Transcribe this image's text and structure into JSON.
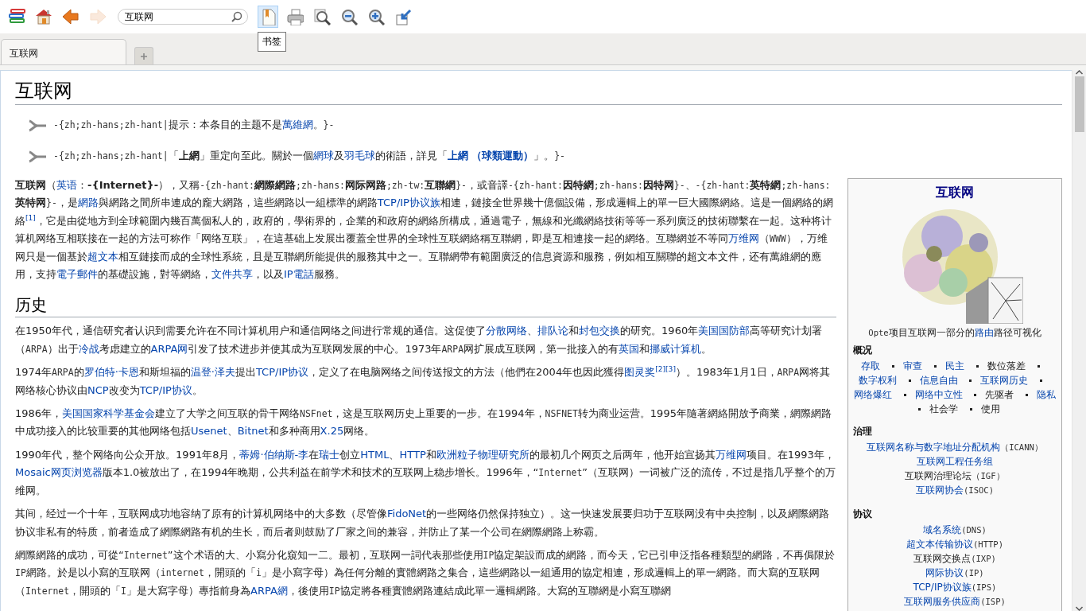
{
  "toolbar": {
    "nav_buttons": [
      {
        "kind": "library",
        "disabled": false
      },
      {
        "kind": "home",
        "disabled": false
      },
      {
        "kind": "back",
        "disabled": false
      },
      {
        "kind": "forward",
        "disabled": true
      }
    ],
    "search": {
      "value": "互联网"
    },
    "tool_buttons": [
      {
        "kind": "bookmark",
        "highlighted": true
      },
      {
        "kind": "print",
        "highlighted": false
      },
      {
        "kind": "zoom-reset",
        "highlighted": false
      },
      {
        "kind": "zoom-out",
        "highlighted": false
      },
      {
        "kind": "zoom-in",
        "highlighted": false
      },
      {
        "kind": "export",
        "highlighted": false
      }
    ],
    "tooltip": "书签"
  },
  "tabs": [
    {
      "label": "互联网",
      "selected": true
    }
  ],
  "article": {
    "title": "互联网",
    "hatnotes": [
      [
        {
          "mono": "-{zh;zh-hans;zh-hant|"
        },
        "提示：本条目的主题不是",
        {
          "link": "萬維網"
        },
        "。",
        {
          "mono": "}-"
        }
      ],
      [
        {
          "mono": "-{zh;zh-hans;zh-hant|"
        },
        "「",
        {
          "bold": "上網"
        },
        "」重定向至此。關於一個",
        {
          "link": "網球"
        },
        "及",
        {
          "link": "羽毛球"
        },
        "的術語，詳見「",
        {
          "boldlink": "上網 （球類運動）"
        },
        "」。",
        {
          "mono": "}-"
        }
      ]
    ],
    "intro": [
      {
        "bold": "互联网"
      },
      "（",
      {
        "link": "英语"
      },
      "：",
      {
        "bold": "-{Internet}-"
      },
      "），又稱",
      {
        "mono": "-{zh-hant:"
      },
      {
        "bold": "網際網路"
      },
      {
        "mono": ";zh-hans:"
      },
      {
        "bold": "网际网路"
      },
      {
        "mono": ";zh-tw:"
      },
      {
        "bold": "互聯網"
      },
      {
        "mono": "}-"
      },
      "，或音譯",
      {
        "mono": "-{zh-hant:"
      },
      {
        "bold": "因特網"
      },
      {
        "mono": ";zh-hans:"
      },
      {
        "bold": "因特网"
      },
      {
        "mono": "}-"
      },
      "、",
      {
        "mono": "-{zh-hant:"
      },
      {
        "bold": "英特網"
      },
      {
        "mono": ";zh-hans:"
      },
      {
        "bold": "英特网"
      },
      {
        "mono": "}-"
      },
      "，是",
      {
        "link": "網路"
      },
      "與網路之間所串連成的龐大網路，這些網路以一組標準的網路",
      {
        "link": "TCP/IP协议族"
      },
      "相連，鏈接全世界幾十億個設備，形成邏輯上的單一巨大國際網絡。這是一個網絡的網絡",
      {
        "ref": "[1]"
      },
      "，它是由從地方到全球範圍內幾百萬個私人的，政府的，學術界的，企業的和政府的網絡所構成，通過電子，無線和光纖網絡技術等等一系列廣泛的技術聯繫在一起。这种将计算机网络互相联接在一起的方法可称作「网络互联」，在這基础上发展出覆蓋全世界的全球性互联網絡稱互聯網，即是互相連接一起的網络。互聯網並不等同",
      {
        "link": "万维网"
      },
      "（",
      {
        "mono": "WWW"
      },
      "），万维网只是一個基於",
      {
        "link": "超文本"
      },
      "相互鏈接而成的全球性系統，且是互聯網所能提供的服務其中之一。互聯網帶有範圍廣泛的信息資源和服務，例如相互關聯的超文本文件，还有萬維網的應用，支持",
      {
        "link": "電子郵件"
      },
      "的基礎設施，對等網絡，",
      {
        "link": "文件共享"
      },
      "，以及",
      {
        "link": "IP電話"
      },
      "服務。"
    ],
    "sections": [
      {
        "heading": "历史",
        "paragraphs": [
          [
            "在1950年代，通信研究者认识到需要允许在不同计算机用户和通信网络之间进行常规的通信。这促使了",
            {
              "link": "分散网络"
            },
            "、",
            {
              "link": "排队论"
            },
            "和",
            {
              "link": "封包交换"
            },
            "的研究。1960年",
            {
              "link": "美国国防部"
            },
            "高等研究计划署（",
            {
              "mono": "ARPA"
            },
            "）出于",
            {
              "link": "冷战"
            },
            "考虑建立的",
            {
              "link": "ARPA网"
            },
            "引发了技术进步并使其成为互联网发展的中心。1973年",
            {
              "mono": "ARPA"
            },
            "网扩展成互联网，第一批接入的有",
            {
              "link": "英国"
            },
            "和",
            {
              "link": "挪威计算机"
            },
            "。"
          ],
          [
            "1974年",
            {
              "mono": "ARPA"
            },
            "的",
            {
              "link": "罗伯特·卡恩"
            },
            "和斯坦福的",
            {
              "link": "温登·泽夫"
            },
            "提出",
            {
              "link": "TCP/IP协议"
            },
            "，定义了在电脑网络之间传送报文的方法（他們在2004年也因此獲得",
            {
              "link": "图灵奖"
            },
            {
              "ref": "[2]"
            },
            {
              "ref": "[3]"
            },
            "）。1983年1月1日，",
            {
              "mono": "ARPA"
            },
            "网将其网络核心协议由",
            {
              "link": "NCP"
            },
            "改变为",
            {
              "link": "TCP/IP协议"
            },
            "。"
          ],
          [
            "1986年，",
            {
              "link": "美国国家科学基金会"
            },
            "建立了大学之间互联的骨干网络",
            {
              "mono": "NSFnet"
            },
            "，这是互联网历史上重要的一步。在1994年，",
            {
              "mono": "NSFNET"
            },
            "转为商业运营。1995年隨著網絡開放予商業，網際網路中成功接入的比较重要的其他网络包括",
            {
              "link": "Usenet"
            },
            "、",
            {
              "link": "Bitnet"
            },
            "和多种商用",
            {
              "link": "X.25"
            },
            "网络。"
          ],
          [
            "1990年代，整个网络向公众开放。1991年8月，",
            {
              "link": "蒂姆·伯纳斯-李"
            },
            "在",
            {
              "link": "瑞士"
            },
            "创立",
            {
              "link": "HTML"
            },
            "、",
            {
              "link": "HTTP"
            },
            "和",
            {
              "link": "欧洲粒子物理研究所"
            },
            "的最初几个网页之后两年，他开始宣扬其",
            {
              "link": "万维网"
            },
            "项目。在1993年，",
            {
              "link": "Mosaic网页浏览器"
            },
            "版本1.0被放出了，在1994年晚期，公共利益在前学术和技术的互联网上稳步增长。1996年，“",
            {
              "mono": "Internet"
            },
            "”（互联网）一词被广泛的流传，不过是指几乎整个的万维网。"
          ],
          [
            "其间，经过一个十年，互联网成功地容纳了原有的计算机网络中的大多数（尽管像",
            {
              "link": "FidoNet"
            },
            "的一些网络仍然保持独立）。这一快速发展要归功于互联网没有中央控制，以及網際網路协议非私有的特质，前者造成了網際網路有机的生长，而后者则鼓励了厂家之间的兼容，并防止了某一个公司在網際網路上称霸。"
          ],
          [
            "網際網路的成功，可從“",
            {
              "mono": "Internet"
            },
            "”这个术语的大、小寫分化窺知一二。最初，互联网一詞代表那些使用",
            {
              "mono": "IP"
            },
            "協定架設而成的網路，而今天，它已引申泛指各種類型的網路，不再侷限於",
            {
              "mono": "IP"
            },
            "網路。於是以小寫的互联网（",
            {
              "mono": "internet"
            },
            "，開頭的「",
            {
              "mono": "i"
            },
            "」是小寫字母）為任何分離的實體網路之集合，這些網路以一組通用的協定相連，形成邏輯上的單一網路。而大寫的互联网（",
            {
              "mono": "Internet"
            },
            "，開頭的「",
            {
              "mono": "I"
            },
            "」是大寫字母）專指前身為",
            {
              "link": "ARPA網"
            },
            "，後使用",
            {
              "mono": "IP"
            },
            "協定將各種實體網路連結成此單一邏輯網路。大寫的互聯網是小寫互聯網"
          ]
        ]
      }
    ]
  },
  "infobox": {
    "title": "互联网",
    "caption": [
      {
        "mono": "Opte"
      },
      "项目互联网一部分的",
      {
        "link": "路由"
      },
      "路径可视化"
    ],
    "sections": [
      {
        "heading": "概况",
        "kind": "inline",
        "items": [
          {
            "text": "存取",
            "link": true
          },
          {
            "text": "审查",
            "link": true
          },
          {
            "text": "民主",
            "link": true
          },
          {
            "text": "数位落差",
            "link": false
          },
          {
            "text": "数字权利",
            "link": true
          },
          {
            "text": "信息自由",
            "link": true
          },
          {
            "text": "互联网历史",
            "link": true
          },
          {
            "text": "网络爆红",
            "link": true
          },
          {
            "text": "网络中立性",
            "link": true
          },
          {
            "text": "先驱者",
            "link": false
          },
          {
            "text": "隐私",
            "link": true
          },
          {
            "text": "社会学",
            "link": false
          },
          {
            "text": "使用",
            "link": false
          }
        ]
      },
      {
        "heading": "治理",
        "kind": "lines",
        "lines": [
          [
            {
              "link": "互联网名称与数字地址分配机构"
            },
            {
              "mono": "（ICANN）"
            }
          ],
          [
            {
              "link": "互联网工程任务组"
            }
          ],
          [
            "互联网治理论坛",
            {
              "mono": "（IGF）"
            }
          ],
          [
            {
              "link": "互联网协会"
            },
            {
              "mono": "(ISOC)"
            }
          ]
        ]
      },
      {
        "heading": "协议",
        "kind": "lines",
        "lines": [
          [
            {
              "link": "域名系统"
            },
            {
              "mono": "(DNS)"
            }
          ],
          [
            {
              "link": "超文本传输协议"
            },
            {
              "mono": "(HTTP)"
            }
          ],
          [
            "互联网交换点",
            {
              "mono": "(IXP)"
            }
          ],
          [
            {
              "link": "网际协议"
            },
            {
              "mono": "(IP)"
            }
          ],
          [
            {
              "link": "TCP/IP协议族"
            },
            {
              "mono": "(IPS)"
            }
          ],
          [
            {
              "link": "互联网服务供应商"
            },
            {
              "mono": "(ISP)"
            }
          ]
        ]
      }
    ]
  }
}
